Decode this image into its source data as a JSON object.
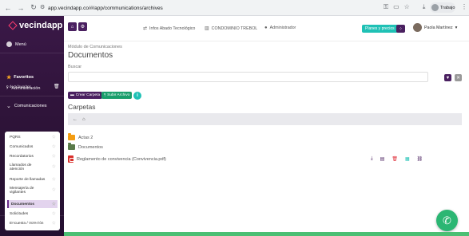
{
  "browser": {
    "url": "app.vecindapp.co/#/app/communications/archives",
    "profile_label": "Trabajo"
  },
  "sidebar": {
    "brand": "vecindapp",
    "menu_label": "Menú",
    "favorites_title": "Favoritos",
    "favorites_count": "0 de 5 favoritos",
    "sections": {
      "administracion": "Administración",
      "comunicaciones": "Comunicaciones",
      "seguridad": "Seguridad 360"
    },
    "submenu": [
      {
        "label": "PQRS"
      },
      {
        "label": "Comunicados"
      },
      {
        "label": "Recordatorios"
      },
      {
        "label": "Llamados de atención"
      },
      {
        "label": "Reporte de llamadas"
      },
      {
        "label": "Mensajería de vigilantes"
      },
      {
        "label": "Documentos"
      },
      {
        "label": "Solicitudes"
      },
      {
        "label": "Encuesta / Votación"
      }
    ]
  },
  "topbar": {
    "info1": "Infos Abado Tecnológico",
    "info2": "CONDOMINIO TREBOL",
    "info3": "Administrador",
    "plans_button": "Planes y precios",
    "user_name": "Paola Martínez"
  },
  "main": {
    "module": "Módulo de Comunicaciones",
    "title": "Documentos",
    "search_label": "Buscar",
    "search_placeholder": "",
    "btn_crear": "Crear Carpeta",
    "btn_subir": "Subir Archivo",
    "folders_title": "Carpetas",
    "rows": [
      {
        "name": "Actas 2",
        "kind": "folder",
        "color": "#f39c12"
      },
      {
        "name": "Documentos",
        "kind": "folder",
        "color": "#5a7a4a"
      },
      {
        "name": "Reglamento de convivencia (Convivencia.pdf)",
        "kind": "pdf",
        "color": "#d9302c"
      }
    ]
  },
  "colors": {
    "sidebar": "#2b1235",
    "accent_purple": "#4a2060",
    "teal": "#1fc1b5",
    "green": "#1a9e6b"
  }
}
